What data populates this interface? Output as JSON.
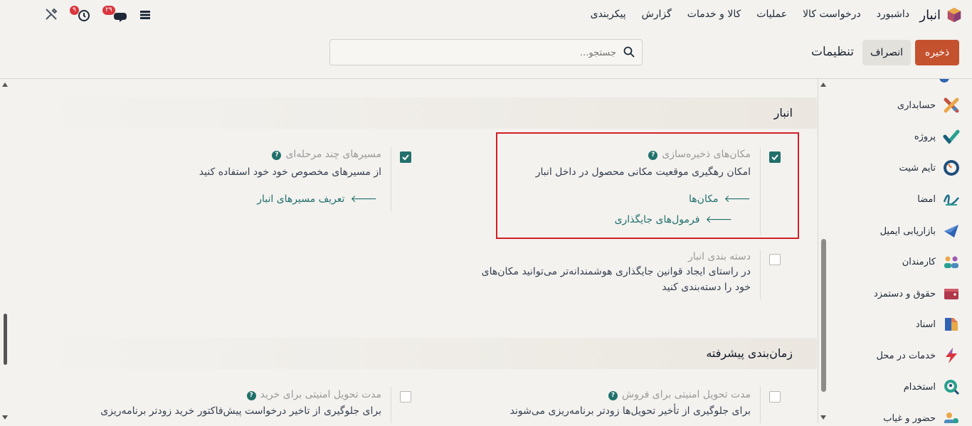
{
  "topbar": {
    "app_name": "انبار",
    "menu": [
      "داشبورد",
      "درخواست کالا",
      "عملیات",
      "کالا و خدمات",
      "گزارش",
      "پیکربندی"
    ],
    "badge_messages": "۲۹",
    "badge_activities": "۹"
  },
  "controls": {
    "save_label": "ذخیره",
    "discard_label": "انصراف",
    "title": "تنظیمات",
    "search_placeholder": "جستجو..."
  },
  "sections": {
    "warehouse": {
      "title": "انبار",
      "multi_step": {
        "title": "مسیرهای چند مرحله‌ای",
        "desc": "از مسیرهای مخصوص خود خود استفاده کنید",
        "link": "تعریف مسیرهای انبار",
        "checked": true
      },
      "storage": {
        "title": "مکان‌های ذخیره‌سازی",
        "desc": "امکان رهگیری موقعیت مکانی محصول در داخل انبار",
        "link1": "مکان‌ها",
        "link2": "فرمول‌های جایگذاری",
        "checked": true
      },
      "categories": {
        "title": "دسته بندی انبار",
        "desc1": "در راستای ایجاد قوانین جایگذاری هوشمندانه‌تر می‌توانید مکان‌های",
        "desc2": "خود را دسته‌بندی کنید",
        "checked": false
      }
    },
    "scheduling": {
      "title": "زمان‌بندی پیشرفته",
      "sales_lead": {
        "title": "مدت تحویل امنیتی برای فروش",
        "desc": "برای جلوگیری از تأخیر تحویل‌ها زودتر برنامه‌ریزی می‌شوند"
      },
      "purchase_lead": {
        "title": "مدت تحویل امنیتی برای خرید",
        "desc": "برای جلوگیری از تاخیر درخواست پیش‌فاکتور خرید زودتر برنامه‌ریزی"
      }
    }
  },
  "sidebar": {
    "items": [
      "حسابداری",
      "پروژه",
      "تایم شیت",
      "امضا",
      "بازاریابی ایمیل",
      "کارمندان",
      "حقوق و دستمزد",
      "اسناد",
      "خدمات در محل",
      "استخدام",
      "حضور و غیاب"
    ]
  },
  "colors": {
    "accent": "#c5522f",
    "teal": "#21706c",
    "highlight": "#d11f24"
  }
}
